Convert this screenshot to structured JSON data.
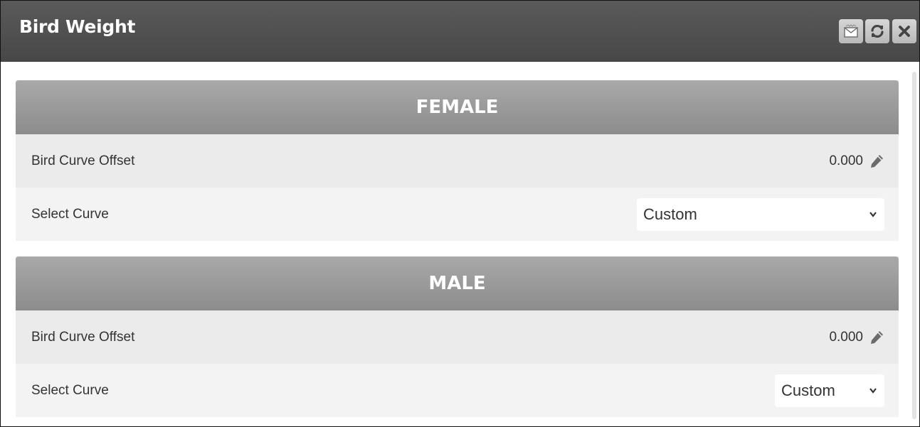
{
  "window": {
    "title": "Bird Weight",
    "buttons": [
      {
        "icon": "mail-icon"
      },
      {
        "icon": "refresh-icon"
      },
      {
        "icon": "close-icon"
      }
    ]
  },
  "sections": [
    {
      "header": "FEMALE",
      "offset_label": "Bird Curve Offset",
      "offset_value": "0.000",
      "curve_label": "Select Curve",
      "curve_selected": "Custom"
    },
    {
      "header": "MALE",
      "offset_label": "Bird Curve Offset",
      "offset_value": "0.000",
      "curve_label": "Select Curve",
      "curve_selected": "Custom"
    }
  ],
  "colors": {
    "titlebar": "#4f4f4f",
    "section_header": "#9b9b9b",
    "row_bg": "#f3f3f3",
    "pencil": "#6b6b6b"
  }
}
